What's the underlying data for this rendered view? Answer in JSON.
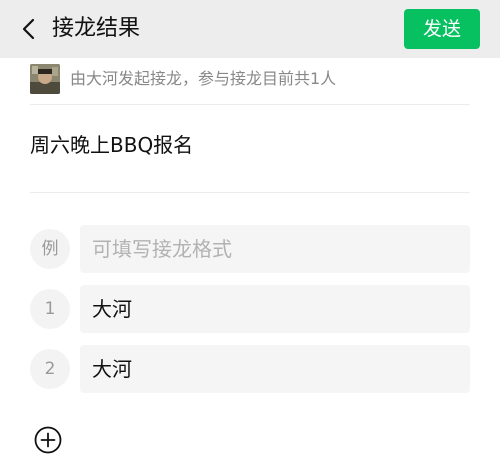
{
  "header": {
    "title": "接龙结果",
    "send_label": "发送"
  },
  "initiator": {
    "text": "由大河发起接龙，参与接龙目前共1人"
  },
  "topic": "周六晚上BBQ报名",
  "example": {
    "marker": "例",
    "placeholder": "可填写接龙格式"
  },
  "entries": [
    {
      "number": "1",
      "name": "大河"
    },
    {
      "number": "2",
      "name": "大河"
    }
  ],
  "icons": {
    "back": "chevron-left-icon",
    "add": "plus-circle-icon"
  },
  "colors": {
    "accent": "#07c160",
    "header_bg": "#ededed"
  }
}
